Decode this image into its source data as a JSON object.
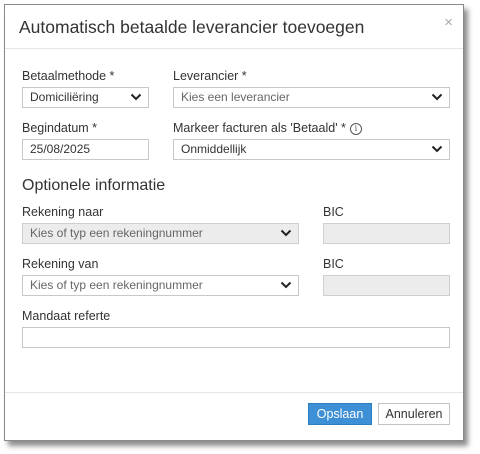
{
  "dialog": {
    "title": "Automatisch betaalde leverancier toevoegen",
    "close_glyph": "×"
  },
  "form": {
    "payment_method": {
      "label": "Betaalmethode *",
      "value": "Domiciliëring"
    },
    "supplier": {
      "label": "Leverancier *",
      "placeholder": "Kies een leverancier"
    },
    "start_date": {
      "label": "Begindatum *",
      "value": "25/08/2025"
    },
    "mark_paid": {
      "label": "Markeer facturen als 'Betaald' *",
      "value": "Onmiddellijk",
      "info_glyph": "i"
    },
    "optional_section": "Optionele informatie",
    "account_to": {
      "label": "Rekening naar",
      "placeholder": "Kies of typ een rekeningnummer"
    },
    "bic_to": {
      "label": "BIC",
      "value": ""
    },
    "account_from": {
      "label": "Rekening van",
      "placeholder": "Kies of typ een rekeningnummer"
    },
    "bic_from": {
      "label": "BIC",
      "value": ""
    },
    "mandate_ref": {
      "label": "Mandaat referte",
      "value": ""
    }
  },
  "footer": {
    "save_label": "Opslaan",
    "cancel_label": "Annuleren"
  },
  "icons": {
    "dropdown": "chevron-down-icon",
    "info": "info-icon",
    "close": "close-icon"
  },
  "colors": {
    "primary": "#3d8fd6",
    "disabled_bg": "#ececec",
    "border": "#c8c8c8"
  }
}
